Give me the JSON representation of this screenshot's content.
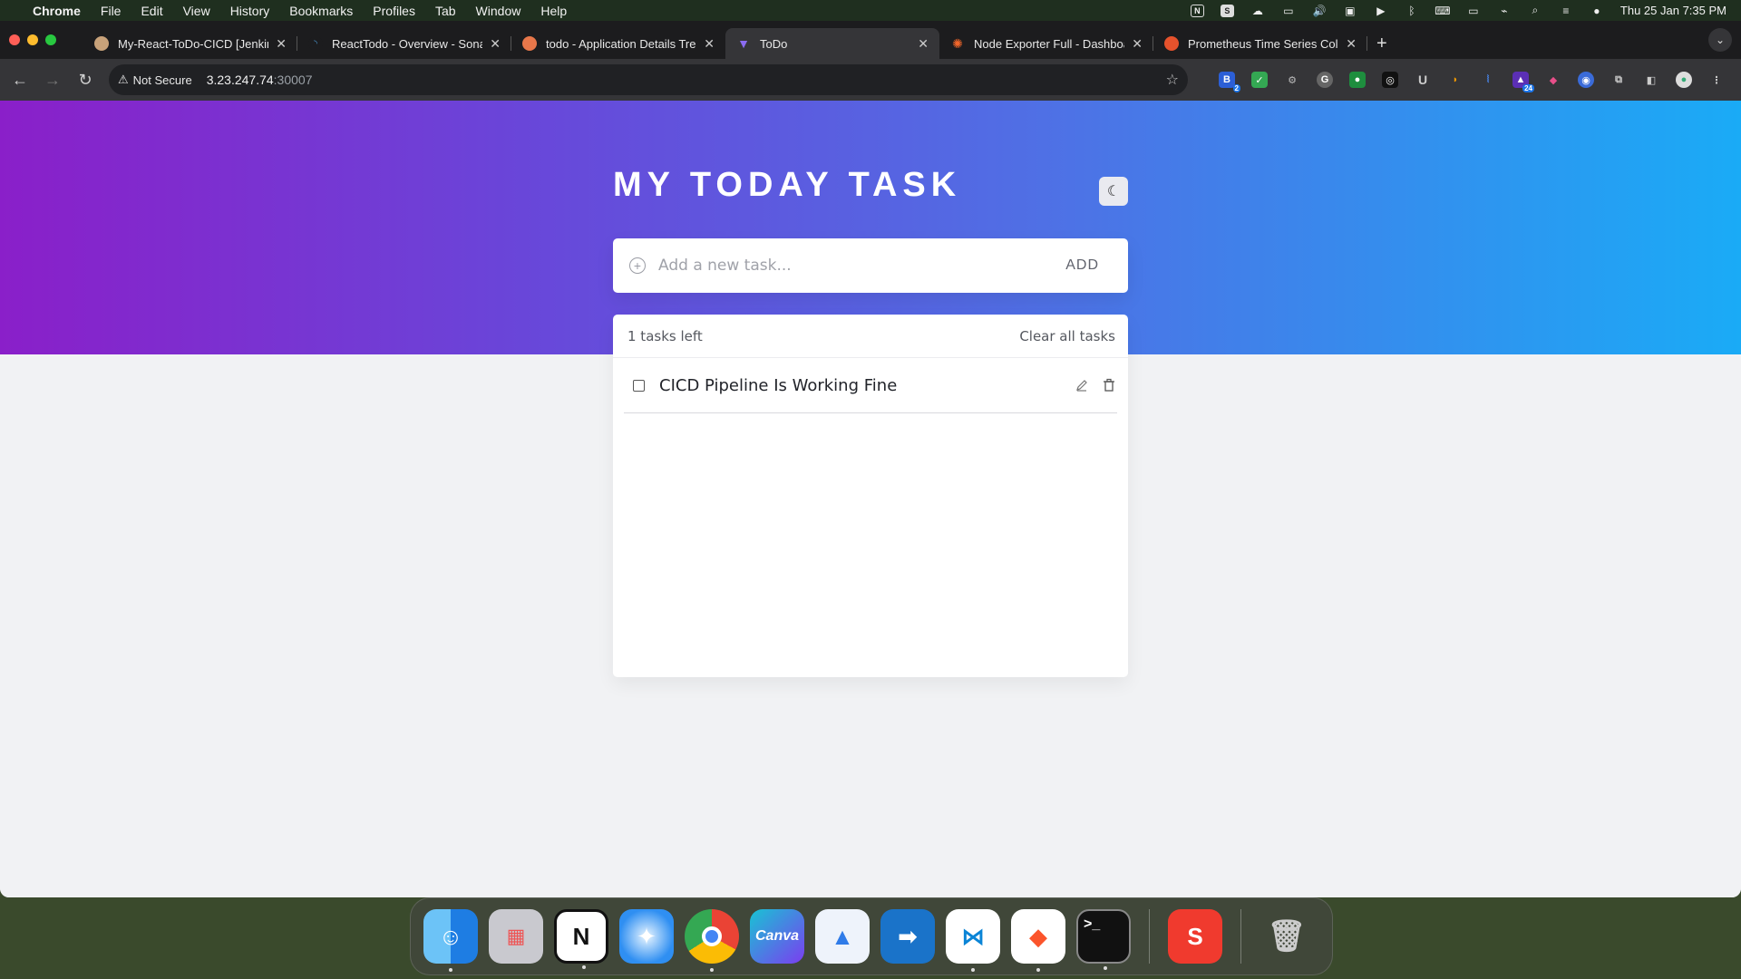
{
  "menubar": {
    "app_name": "Chrome",
    "menus": [
      "File",
      "Edit",
      "View",
      "History",
      "Bookmarks",
      "Profiles",
      "Tab",
      "Window",
      "Help"
    ],
    "datetime": "Thu 25 Jan  7:35 PM"
  },
  "browser": {
    "tabs": [
      {
        "title": "My-React-ToDo-CICD [Jenkins]",
        "favicon_color": "#c8a27a"
      },
      {
        "title": "ReactTodo - Overview - SonarQube",
        "favicon_color": "#4c9bd6"
      },
      {
        "title": "todo - Application Details Tree",
        "favicon_color": "#e8774a"
      },
      {
        "title": "ToDo",
        "favicon_color": "#8b6cf2"
      },
      {
        "title": "Node Exporter Full - Dashboard",
        "favicon_color": "#f0662b"
      },
      {
        "title": "Prometheus Time Series Collection",
        "favicon_color": "#e6522c"
      }
    ],
    "active_tab_index": 3,
    "address": {
      "security_label": "Not Secure",
      "host": "3.23.247.74",
      "port": ":30007"
    },
    "extension_badge": "24",
    "extension_count_badge": "2"
  },
  "app": {
    "title": "MY TODAY TASK",
    "input_placeholder": "Add a new task...",
    "add_label": "ADD",
    "tasks_left": "1 tasks left",
    "clear_label": "Clear all tasks",
    "tasks": [
      {
        "text": "CICD Pipeline Is Working Fine",
        "completed": false
      }
    ]
  },
  "dock": {
    "apps": [
      "Finder",
      "Launchpad",
      "Notion",
      "Safari",
      "Chrome",
      "Canva",
      "Spark",
      "Remote Desktop",
      "VS Code",
      "Brave",
      "Terminal",
      "Sketchbook",
      "Trash"
    ]
  },
  "colors": {
    "gradient_start": "#8a1fc9",
    "gradient_end": "#1aabf6"
  }
}
